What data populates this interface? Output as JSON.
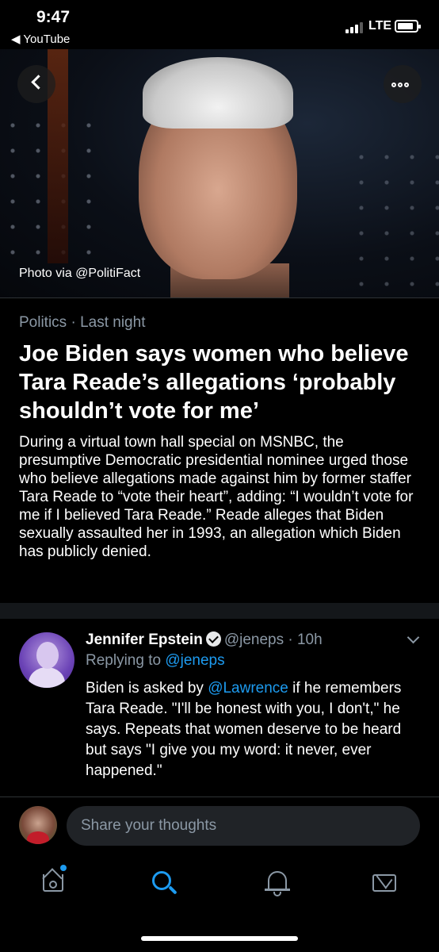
{
  "status_bar": {
    "time": "9:47",
    "back_app": "◀ YouTube",
    "network": "LTE",
    "battery_level": 0.85
  },
  "hero": {
    "caption": "Photo via @PolitiFact",
    "back_icon": "chevron-left-icon",
    "more_icon": "more-horizontal-icon"
  },
  "article": {
    "category": "Politics",
    "separator": " · ",
    "time": "Last night",
    "headline": "Joe Biden says women who believe Tara Reade’s allegations ‘probably shouldn’t vote for me’",
    "summary": "During a virtual town hall special on MSNBC, the presumptive Democratic presidential nominee urged those who believe allegations made against him by former staffer Tara Reade to “vote their heart”, adding: “I wouldn’t vote for me if I believed Tara Reade.” Reade alleges that Biden sexually assaulted her in 1993, an allegation which Biden has publicly denied."
  },
  "tweet": {
    "author": "Jennifer Epstein",
    "handle": "@jeneps",
    "time": " · 10h",
    "replying_prefix": "Replying to ",
    "replying_to": "@jeneps",
    "text_before": "Biden is asked by ",
    "mention": "@Lawrence",
    "text_after": " if he remembers Tara Reade. \"I'll be honest with you, I don't,\" he says. Repeats that women deserve to be heard but says \"I give you my word: it never, ever happened.\""
  },
  "compose": {
    "placeholder": "Share your thoughts"
  },
  "tabs": [
    {
      "name": "home",
      "icon": "home-icon",
      "active": false,
      "badge": true
    },
    {
      "name": "search",
      "icon": "search-icon",
      "active": true
    },
    {
      "name": "notifications",
      "icon": "bell-icon",
      "active": false
    },
    {
      "name": "messages",
      "icon": "envelope-icon",
      "active": false
    }
  ],
  "colors": {
    "background": "#000000",
    "accent": "#1d9bf0",
    "secondary_text": "#8b98a5",
    "divider": "#2f3336"
  }
}
